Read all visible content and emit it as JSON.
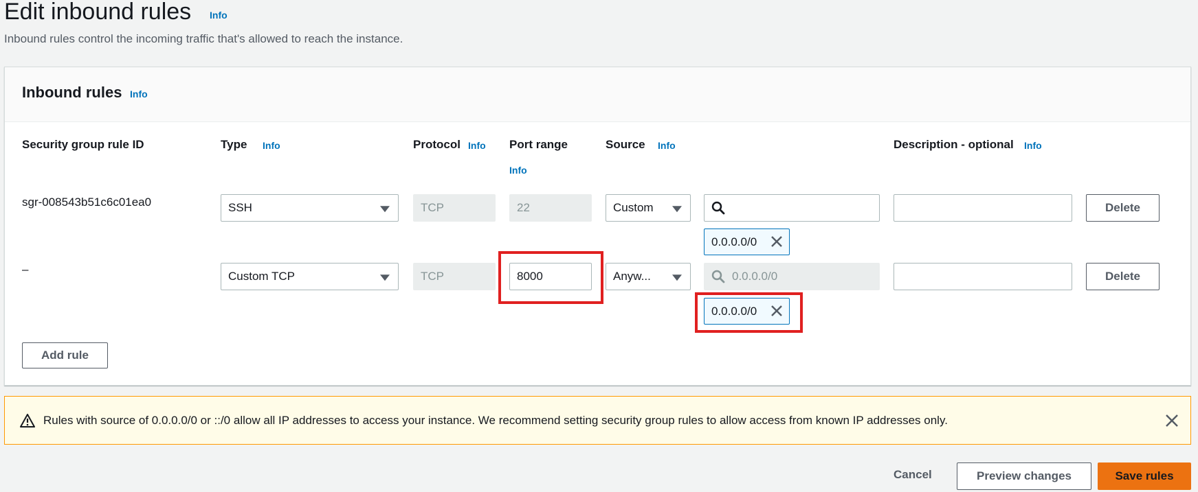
{
  "header": {
    "title": "Edit inbound rules",
    "info": "Info",
    "subtitle": "Inbound rules control the incoming traffic that's allowed to reach the instance."
  },
  "panel": {
    "title": "Inbound rules",
    "info": "Info",
    "columns": {
      "rule_id": "Security group rule ID",
      "type": "Type",
      "type_info": "Info",
      "protocol": "Protocol",
      "protocol_info": "Info",
      "port_range": "Port range",
      "port_range_info": "Info",
      "source": "Source",
      "source_info": "Info",
      "description": "Description - optional",
      "description_info": "Info"
    },
    "rules": [
      {
        "rule_id": "sgr-008543b51c6c01ea0",
        "type": "SSH",
        "protocol": "TCP",
        "port_range": "22",
        "source": "Custom",
        "search_value": "",
        "token": "0.0.0.0/0",
        "description": "",
        "delete_label": "Delete"
      },
      {
        "rule_id": "–",
        "type": "Custom TCP",
        "protocol": "TCP",
        "port_range": "8000",
        "source": "Anyw...",
        "search_placeholder": "0.0.0.0/0",
        "token": "0.0.0.0/0",
        "description": "",
        "delete_label": "Delete"
      }
    ],
    "add_rule_label": "Add rule"
  },
  "alert": {
    "text": "Rules with source of 0.0.0.0/0 or ::/0 allow all IP addresses to access your instance. We recommend setting security group rules to allow access from known IP addresses only."
  },
  "footer": {
    "cancel_label": "Cancel",
    "preview_label": "Preview changes",
    "save_label": "Save rules"
  },
  "icons": {
    "warning": "warning-icon",
    "close": "close-icon",
    "search": "search-icon",
    "dropdown": "caret-down-icon"
  },
  "colors": {
    "primary": "#ec7211",
    "link": "#0073bb",
    "highlight": "#e02020",
    "alert_border": "#ff9900"
  }
}
